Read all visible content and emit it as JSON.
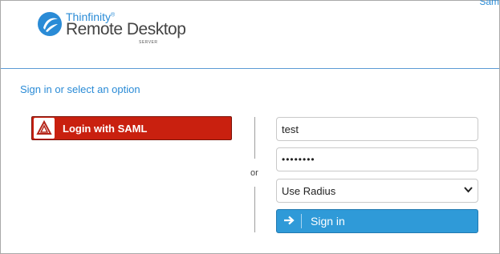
{
  "header": {
    "corner_link": "Sam",
    "logo": {
      "brand": "Thinfinity",
      "brand_mark": "®",
      "product": "Remote Desktop",
      "edition": "SERVER"
    }
  },
  "main": {
    "heading": "Sign in or select an option",
    "saml_button": {
      "label": "Login with SAML",
      "icon": "saml-logo-icon"
    },
    "or_label": "or",
    "username": {
      "value": "test",
      "placeholder": ""
    },
    "password": {
      "value": "••••••••",
      "placeholder": ""
    },
    "auth_method": {
      "selected": "Use Radius",
      "icon": "chevron-down-icon"
    },
    "signin_button": {
      "label": "Sign in",
      "icon": "arrow-right-icon"
    }
  },
  "colors": {
    "accent": "#2a8bd6",
    "saml_red": "#c9200f",
    "signin_blue": "#2f9ad8"
  }
}
